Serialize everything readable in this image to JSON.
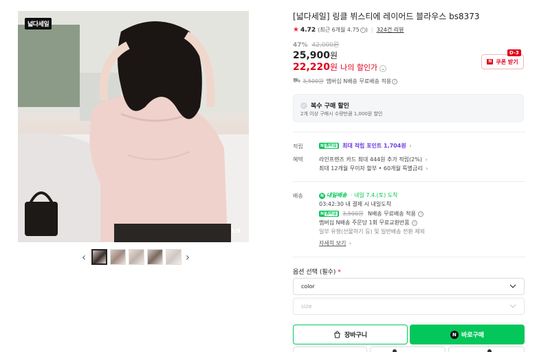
{
  "gallery": {
    "sale_badge": "넓다세일",
    "counter": "1/9",
    "prev_arrow": "‹",
    "next_arrow": "›",
    "thumbnail_count": 5,
    "active_thumbnail": 1
  },
  "product": {
    "title": "[넓다세일] 링클 뷔스티에 레이어드 블라우스 bs8373",
    "rating": {
      "score": "4.72",
      "detail": "(최근 6개월 4.75",
      "detail_close": ")",
      "reviews": "324건 리뷰"
    },
    "price": {
      "discount_rate": "47%",
      "original": "42,000원",
      "sale": "25,900",
      "won": "원",
      "my_price": "22,220",
      "my_price_label": "나의 할인가"
    },
    "coupon": {
      "dday": "D-3",
      "label": "쿠폰 받기",
      "icon": "coupon-icon"
    },
    "shipping_note": {
      "strike_fee": "3,500원",
      "text": "멤버십 N배송 무료배송 적용"
    },
    "multi_purchase": {
      "title": "복수 구매 할인",
      "desc": "2개 이상 구매시 수량만큼 1,000원 할인"
    },
    "benefits": {
      "points_label": "적립",
      "points_badge_n": "N",
      "points_badge_membership": "멤버십",
      "points_text": "최대 적립 포인트 1,704원",
      "perks_label": "혜택",
      "perk1": "라인프렌즈 카드 최대 444원 추가 적립(2%)",
      "perk2": "최대 12개월 무이자 할부 • 60개월 특별금리"
    },
    "delivery": {
      "label": "배송",
      "today_badge": "내일배송",
      "arrival": "· 내일 7.4.(토) 도착",
      "deadline": "03:42:30  내 결제 시 내일도착",
      "membership_strike": "3,500원",
      "membership_text": "N배송 무료배송 적용",
      "exchange": "멤버십 N배송 주문당 1회 무료교환반품",
      "exclusion": "일부 유형(선물하기 등) 및 일반배송 전환 제외",
      "more_link": "자세히 보기"
    },
    "options": {
      "label": "옵션 선택 (필수)",
      "required_mark": "*",
      "color_value": "color",
      "size_placeholder": "size"
    },
    "buttons": {
      "cart": "장바구니",
      "buy": "바로구매",
      "buy_n": "N"
    }
  },
  "colors": {
    "naver_green": "#03c75a",
    "sale_red": "#e0001a",
    "points_purple": "#6c3ce1"
  }
}
